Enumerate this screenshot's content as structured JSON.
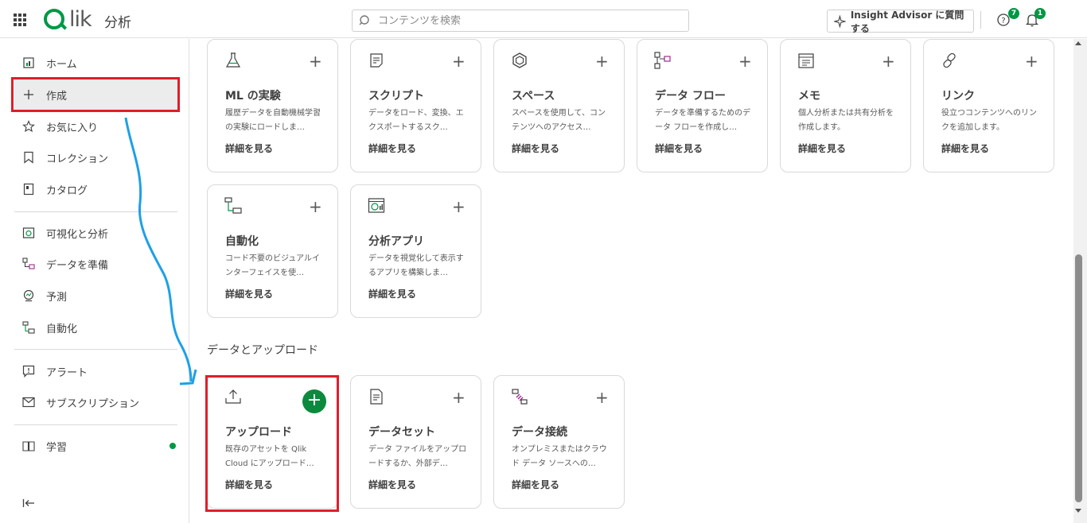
{
  "header": {
    "logo_text": "lik",
    "app_title": "分析",
    "search_placeholder": "コンテンツを検索",
    "insight_label": "Insight Advisor に質問する",
    "help_badge": "7",
    "notifications_badge": "1"
  },
  "sidebar": {
    "items": [
      {
        "label": "ホーム",
        "icon": "home-icon"
      },
      {
        "label": "作成",
        "icon": "plus-icon"
      },
      {
        "label": "お気に入り",
        "icon": "star-icon"
      },
      {
        "label": "コレクション",
        "icon": "bookmark-icon"
      },
      {
        "label": "カタログ",
        "icon": "catalog-icon"
      },
      {
        "label": "可視化と分析",
        "icon": "analytics-icon"
      },
      {
        "label": "データを準備",
        "icon": "data-prep-icon"
      },
      {
        "label": "予測",
        "icon": "predict-icon"
      },
      {
        "label": "自動化",
        "icon": "automation-icon"
      },
      {
        "label": "アラート",
        "icon": "alert-icon"
      },
      {
        "label": "サブスクリプション",
        "icon": "subscription-icon"
      },
      {
        "label": "学習",
        "icon": "book-icon"
      }
    ]
  },
  "cards_row1": [
    {
      "title": "ML の実験",
      "desc": "履歴データを自動機械学習の実験にロードしま…",
      "more": "詳細を見る",
      "icon": "flask-icon"
    },
    {
      "title": "スクリプト",
      "desc": "データをロード、変換、エクスポートするスク…",
      "more": "詳細を見る",
      "icon": "script-icon"
    },
    {
      "title": "スペース",
      "desc": "スペースを使用して、コンテンツへのアクセス…",
      "more": "詳細を見る",
      "icon": "space-icon"
    },
    {
      "title": "データ フロー",
      "desc": "データを準備するためのデータ フローを作成し…",
      "more": "詳細を見る",
      "icon": "dataflow-icon"
    },
    {
      "title": "メモ",
      "desc": "個人分析または共有分析を作成します。",
      "more": "詳細を見る",
      "icon": "note-icon"
    },
    {
      "title": "リンク",
      "desc": "役立つコンテンツへのリンクを追加します。",
      "more": "詳細を見る",
      "icon": "link-icon"
    }
  ],
  "cards_row2": [
    {
      "title": "自動化",
      "desc": "コード不要のビジュアルインターフェイスを使…",
      "more": "詳細を見る",
      "icon": "automation-icon"
    },
    {
      "title": "分析アプリ",
      "desc": "データを視覚化して表示するアプリを構築しま…",
      "more": "詳細を見る",
      "icon": "app-icon"
    }
  ],
  "section_data": {
    "title": "データとアップロード",
    "cards": [
      {
        "title": "アップロード",
        "desc": "既存のアセットを Qlik Cloud にアップロード…",
        "more": "詳細を見る",
        "icon": "upload-icon"
      },
      {
        "title": "データセット",
        "desc": "データ ファイルをアップロードするか、外部デ…",
        "more": "詳細を見る",
        "icon": "dataset-icon"
      },
      {
        "title": "データ接続",
        "desc": "オンプレミスまたはクラウド データ ソースへの…",
        "more": "詳細を見る",
        "icon": "connection-icon"
      }
    ]
  },
  "colors": {
    "brand": "#009845",
    "highlight": "#e11d2a",
    "annotation_arrow": "#1ea0e6"
  }
}
